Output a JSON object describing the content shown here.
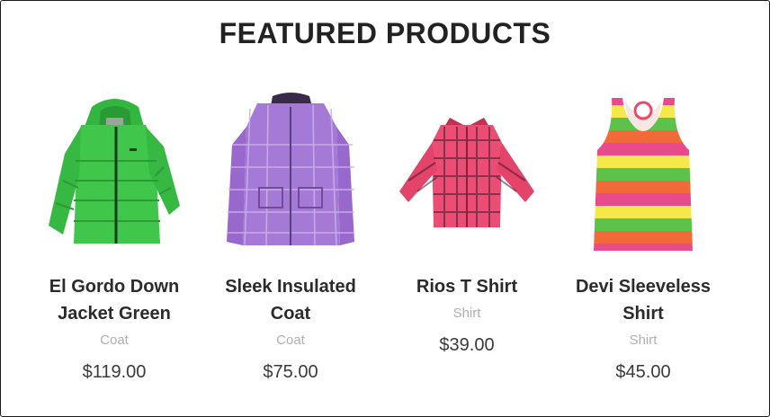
{
  "section": {
    "title": "FEATURED PRODUCTS"
  },
  "products": [
    {
      "name": "El Gordo Down Jacket Green",
      "category": "Coat",
      "price": "$119.00",
      "image": "green-puffer-jacket",
      "color": "#3fbf4a"
    },
    {
      "name": "Sleek Insulated Coat",
      "category": "Coat",
      "price": "$75.00",
      "image": "purple-plaid-coat",
      "color": "#9b6fc9"
    },
    {
      "name": "Rios T Shirt",
      "category": "Shirt",
      "price": "$39.00",
      "image": "pink-plaid-shirt",
      "color": "#e8476c"
    },
    {
      "name": "Devi Sleeveless Shirt",
      "category": "Shirt",
      "price": "$45.00",
      "image": "striped-tank-top",
      "color": "#e94a8c"
    }
  ]
}
